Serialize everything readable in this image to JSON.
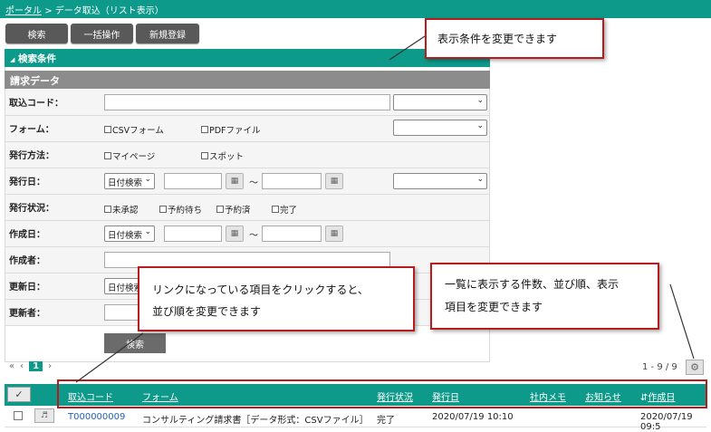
{
  "breadcrumb": {
    "portal": "ポータル",
    "sep": ">",
    "current": "データ取込（リスト表示）"
  },
  "toolbar": {
    "search": "検索",
    "bulk": "一括操作",
    "new": "新規登録"
  },
  "panel": {
    "title": "検索条件",
    "section": "請求データ"
  },
  "fields": {
    "code": "取込コード：",
    "form": "フォーム：",
    "method": "発行方法：",
    "issue_date": "発行日：",
    "issue_status": "発行状況：",
    "created_date": "作成日：",
    "creator": "作成者：",
    "updated_date": "更新日：",
    "updater": "更新者："
  },
  "checks": {
    "csv": "CSVフォーム",
    "pdf": "PDFファイル",
    "mypage": "マイページ",
    "spot": "スポット",
    "unapproved": "未承認",
    "waiting": "予約待ち",
    "reserved": "予約済",
    "done": "完了"
  },
  "date_select": "日付検索",
  "tilde": "～",
  "search_button": "検索",
  "pager": {
    "first": "«",
    "prev": "‹",
    "page": "1",
    "next": "›"
  },
  "count": "1 - 9 / 9",
  "table": {
    "headers": [
      "取込コード",
      "フォーム",
      "発行状況",
      "発行日",
      "社内メモ",
      "お知らせ",
      "作成日"
    ],
    "sort_mark": "⇵",
    "rows": [
      {
        "code": "T000000009",
        "form": "コンサルティング請求書［データ形式：CSVファイル］",
        "status": "完了",
        "issue": "2020/07/19 10:10",
        "created": "2020/07/19 09:5"
      }
    ]
  },
  "callouts": {
    "c1": "表示条件を変更できます",
    "c2_l1": "リンクになっている項目をクリックすると、",
    "c2_l2": "並び順を変更できます",
    "c3_l1": "一覧に表示する件数、並び順、表示",
    "c3_l2": "項目を変更できます"
  },
  "colors": {
    "teal": "#0e9a8a",
    "red": "#b71c1c",
    "dark_button": "#595959"
  },
  "icons": {
    "gear": "gear-icon",
    "calendar": "calendar-icon",
    "note": "note-icon",
    "check": "check-icon"
  }
}
